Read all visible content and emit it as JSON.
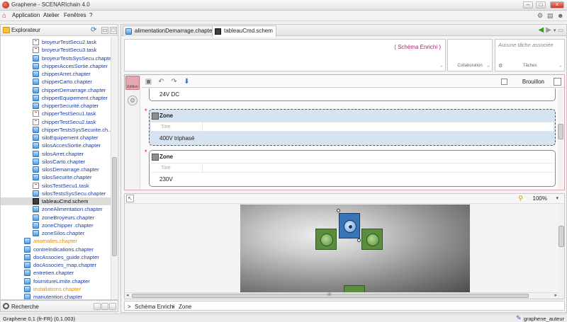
{
  "window": {
    "title": "Graphene - SCENARIchain 4.0"
  },
  "menu": {
    "items": [
      "Application",
      "Atelier",
      "Fenêtres",
      "?"
    ]
  },
  "explorer": {
    "title": "Explorateur",
    "items": [
      {
        "label": "broyeurTestSecu2.task",
        "icon": "task-file-icon",
        "color": "blue"
      },
      {
        "label": "broyeurTestSecu3.task",
        "icon": "task-file-icon",
        "color": "blue"
      },
      {
        "label": "broyeurTestsSysSecu.chapter",
        "icon": "chapter-file-icon",
        "color": "blue"
      },
      {
        "label": "chipperAccesSortie.chapter",
        "icon": "chapter-file-icon",
        "color": "blue"
      },
      {
        "label": "chipperArret.chapter",
        "icon": "chapter-file-icon",
        "color": "blue"
      },
      {
        "label": "chipperCarto.chapter",
        "icon": "chapter-file-icon",
        "color": "blue"
      },
      {
        "label": "chipperDemarrage.chapter",
        "icon": "chapter-file-icon",
        "color": "blue"
      },
      {
        "label": "chipperEquipement.chapter",
        "icon": "chapter-file-icon",
        "color": "blue"
      },
      {
        "label": "chipperSecurité.chapter",
        "icon": "chapter-file-icon",
        "color": "blue"
      },
      {
        "label": "chipperTestSecu1.task",
        "icon": "task-file-icon",
        "color": "blue"
      },
      {
        "label": "chipperTestSecu2.task",
        "icon": "task-file-icon",
        "color": "blue"
      },
      {
        "label": "chipperTestsSysSecurite.ch...",
        "icon": "chapter-file-icon",
        "color": "blue"
      },
      {
        "label": "siloEquipement.chapter",
        "icon": "chapter-file-icon",
        "color": "blue"
      },
      {
        "label": "silosAccesSortie.chapter",
        "icon": "chapter-file-icon",
        "color": "blue"
      },
      {
        "label": "silosArret.chapter",
        "icon": "chapter-file-icon",
        "color": "blue"
      },
      {
        "label": "silosCarto.chapter",
        "icon": "chapter-file-icon",
        "color": "blue"
      },
      {
        "label": "silosDemarrage.chapter",
        "icon": "chapter-file-icon",
        "color": "blue"
      },
      {
        "label": "silosSecurite.chapter",
        "icon": "chapter-file-icon",
        "color": "blue"
      },
      {
        "label": "silosTestSecu1.task",
        "icon": "task-file-icon",
        "color": "blue"
      },
      {
        "label": "silosTestsSysSecu.chapter",
        "icon": "chapter-file-icon",
        "color": "blue"
      },
      {
        "label": "tableauCmd.schem",
        "icon": "schema-file-icon",
        "color": "black",
        "selected": true
      },
      {
        "label": "zoneAlimentation.chapter",
        "icon": "chapter-file-icon",
        "color": "blue"
      },
      {
        "label": "zoneBroyeurs.chapter",
        "icon": "chapter-file-icon",
        "color": "blue"
      },
      {
        "label": "zoneChipper .chapter",
        "icon": "chapter-file-icon",
        "color": "blue"
      },
      {
        "label": "zoneSilos.chapter",
        "icon": "chapter-file-icon",
        "color": "blue"
      },
      {
        "label": "anomalies.chapter",
        "icon": "chapter-file-icon",
        "color": "orange"
      },
      {
        "label": "contreIndications.chapter",
        "icon": "chapter-file-icon",
        "color": "blue"
      },
      {
        "label": "docAssocies_guide.chapter",
        "icon": "chapter-file-icon",
        "color": "blue"
      },
      {
        "label": "docAssocies_map.chapter",
        "icon": "chapter-file-icon",
        "color": "blue"
      },
      {
        "label": "entretien.chapter",
        "icon": "chapter-file-icon",
        "color": "blue"
      },
      {
        "label": "fournitureLimite.chapter",
        "icon": "chapter-file-icon",
        "color": "blue"
      },
      {
        "label": "installations.chapter",
        "icon": "chapter-file-icon",
        "color": "orange"
      },
      {
        "label": "manutention.chapter",
        "icon": "chapter-file-icon",
        "color": "blue"
      }
    ]
  },
  "search": {
    "title": "Recherche"
  },
  "tabs": [
    {
      "label": "alimentationDemarrage.chapter",
      "icon": "chapter-file-icon"
    },
    {
      "label": "tableauCmd.schem",
      "icon": "schema-file-icon",
      "active": true
    }
  ],
  "header": {
    "schema_label": "( Schéma Enrichi )",
    "collab_label": "Collaboration",
    "task_placeholder": "Aucune tâche associée",
    "task_label": "Tâches"
  },
  "edition": {
    "edit_button": "Edition",
    "brouillon": "Brouillon",
    "top_value": "24V DC",
    "zones": [
      {
        "title": "Zone",
        "titre_label": "Titre",
        "value": "400V triphasé",
        "selected": true
      },
      {
        "title": "Zone",
        "titre_label": "Titre",
        "value": "230V",
        "selected": false
      }
    ]
  },
  "schema": {
    "zoom": "100%",
    "scroll_grip": "III"
  },
  "breadcrumb": {
    "sep1": ">",
    "item1": "Schéma Enrichi",
    "sep2": ">",
    "item2": "Zone"
  },
  "status": {
    "left": "Graphene 0.1 (fr-FR) (0.1.003)",
    "user": "graphene_auteur"
  },
  "colors": {
    "accent": "#b0226a",
    "link": "#1c3ea5",
    "orange": "#e08d0b",
    "selection": "#d6e3f0"
  }
}
